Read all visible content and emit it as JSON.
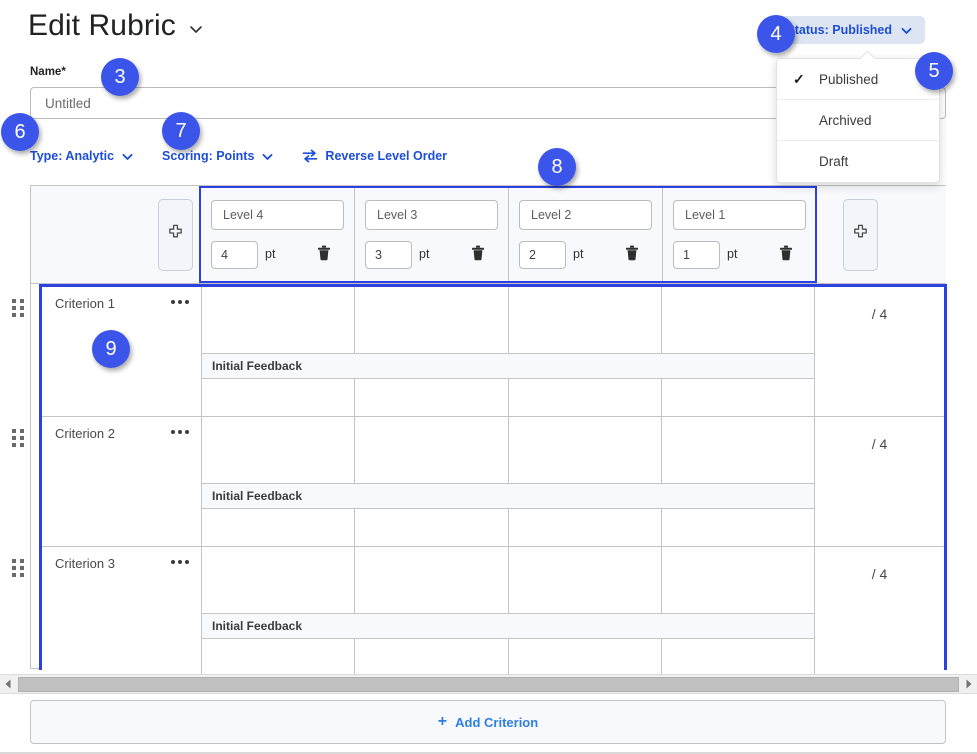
{
  "header": {
    "title": "Edit Rubric",
    "title_caret_icon": "chevron-down-icon"
  },
  "status": {
    "pill_label": "Status: Published",
    "pill_caret_icon": "chevron-down-icon",
    "menu": [
      {
        "label": "Published",
        "checked": true,
        "check_icon": "check-icon"
      },
      {
        "label": "Archived",
        "checked": false
      },
      {
        "label": "Draft",
        "checked": false
      }
    ]
  },
  "name_field": {
    "label": "Name*",
    "value": "",
    "placeholder": "Untitled"
  },
  "options": {
    "type": {
      "label": "Type: Analytic",
      "icon": "chevron-down-icon"
    },
    "scoring": {
      "label": "Scoring: Points",
      "icon": "chevron-down-icon"
    },
    "reverse": {
      "label": "Reverse Level Order",
      "icon": "swap-arrows-icon"
    }
  },
  "table": {
    "add_level_icon": "plus-icon",
    "add_level_left_name": "add-level-button-left",
    "add_level_right_name": "add-level-button-right",
    "levels": [
      {
        "name": "",
        "name_placeholder": "Level 4",
        "points": "4",
        "unit": "pt",
        "delete_icon": "trash-icon"
      },
      {
        "name": "",
        "name_placeholder": "Level 3",
        "points": "3",
        "unit": "pt",
        "delete_icon": "trash-icon"
      },
      {
        "name": "",
        "name_placeholder": "Level 2",
        "points": "2",
        "unit": "pt",
        "delete_icon": "trash-icon"
      },
      {
        "name": "",
        "name_placeholder": "Level 1",
        "points": "1",
        "unit": "pt",
        "delete_icon": "trash-icon"
      }
    ],
    "criteria": [
      {
        "name": "Criterion 1",
        "feedback_label": "Initial Feedback",
        "score": "/ 4",
        "menu_icon": "ellipsis-icon",
        "drag_icon": "drag-handle-icon"
      },
      {
        "name": "Criterion 2",
        "feedback_label": "Initial Feedback",
        "score": "/ 4",
        "menu_icon": "ellipsis-icon",
        "drag_icon": "drag-handle-icon"
      },
      {
        "name": "Criterion 3",
        "feedback_label": "Initial Feedback",
        "score": "/ 4",
        "menu_icon": "ellipsis-icon",
        "drag_icon": "drag-handle-icon"
      }
    ]
  },
  "scrollbar": {
    "left_arrow_icon": "triangle-left-icon",
    "right_arrow_icon": "triangle-right-icon"
  },
  "add_criterion": {
    "label": "Add Criterion",
    "plus": "+"
  },
  "callouts": [
    {
      "id": "3",
      "number": "3"
    },
    {
      "id": "4",
      "number": "4"
    },
    {
      "id": "5",
      "number": "5"
    },
    {
      "id": "6",
      "number": "6"
    },
    {
      "id": "7",
      "number": "7"
    },
    {
      "id": "8",
      "number": "8"
    },
    {
      "id": "9",
      "number": "9"
    }
  ],
  "colors": {
    "accent_blue": "#1d4ed8",
    "badge_blue": "#3b55ea",
    "highlight_outline": "#2c41dd",
    "pill_bg": "#dde5f2",
    "panel_bg": "#f7f9fc",
    "link_blue": "#2f7fe0"
  }
}
